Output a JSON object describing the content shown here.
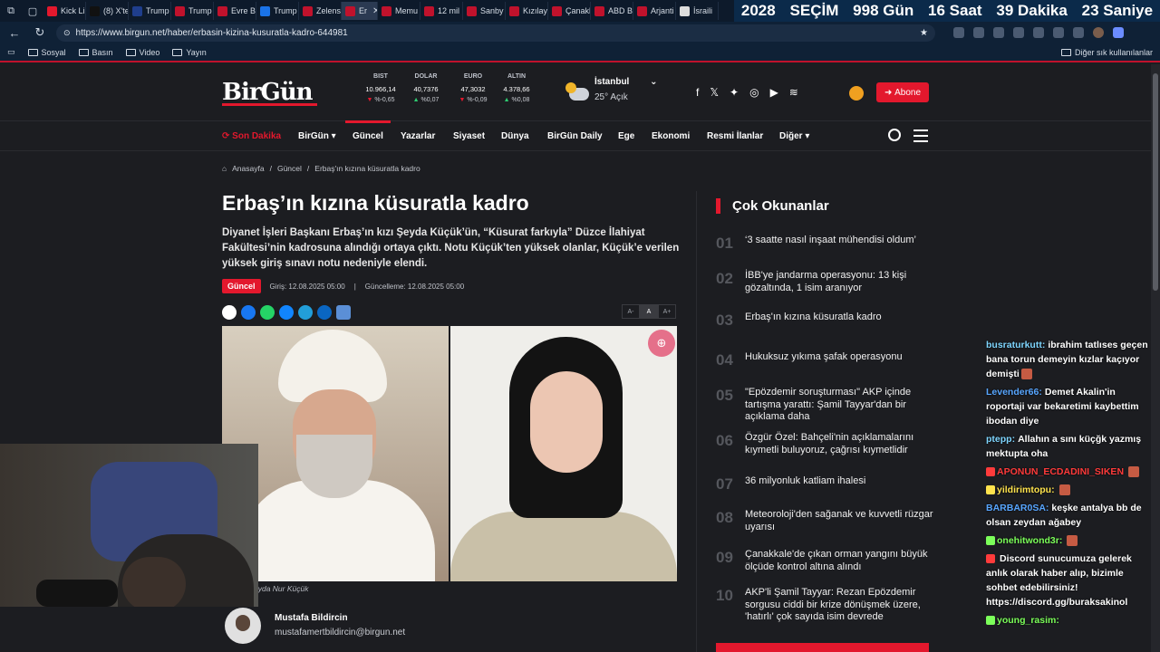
{
  "browser": {
    "tabs": [
      {
        "label": "Kick Li",
        "color": "#e3182d"
      },
      {
        "label": "(8) X'te",
        "color": "#111111"
      },
      {
        "label": "Trump",
        "color": "#1f3e8c"
      },
      {
        "label": "Trump",
        "color": "#c0122c"
      },
      {
        "label": "Evre B",
        "color": "#c0122c"
      },
      {
        "label": "Trump",
        "color": "#1a73e8"
      },
      {
        "label": "Zelens",
        "color": "#c0122c"
      },
      {
        "label": "Er",
        "color": "#c0122c"
      },
      {
        "label": "Memu",
        "color": "#c0122c"
      },
      {
        "label": "12 mil",
        "color": "#c0122c"
      },
      {
        "label": "Sanby",
        "color": "#c0122c"
      },
      {
        "label": "Kızılay",
        "color": "#c0122c"
      },
      {
        "label": "Çanakk",
        "color": "#c0122c"
      },
      {
        "label": "ABD B",
        "color": "#c0122c"
      },
      {
        "label": "Arjanti",
        "color": "#c0122c"
      },
      {
        "label": "İsraili",
        "color": "#dddddd"
      }
    ],
    "url": "https://www.birgun.net/haber/erbasin-kizina-kusuratla-kadro-644981",
    "bookmarks": [
      "Sosyal",
      "Basın",
      "Video",
      "Yayın"
    ],
    "bookmarks_other": "Diğer sık kullanılanlar"
  },
  "countdown": {
    "year": "2028",
    "label": "SEÇİM",
    "days": "998 Gün",
    "hours": "16 Saat",
    "minutes": "39 Dakika",
    "seconds": "23 Saniye"
  },
  "site": {
    "logo": "BirGün",
    "markets": [
      {
        "label": "BIST",
        "value": "10.966,14",
        "change": "%-0,65",
        "dir": "down"
      },
      {
        "label": "DOLAR",
        "value": "40,7376",
        "change": "%0,07",
        "dir": "up"
      },
      {
        "label": "EURO",
        "value": "47,3032",
        "change": "%-0,09",
        "dir": "down"
      },
      {
        "label": "ALTIN",
        "value": "4.378,66",
        "change": "%0,08",
        "dir": "up"
      }
    ],
    "weather": {
      "city": "İstanbul",
      "temp": "25° Açık"
    },
    "subscribe": "Abone",
    "nav": [
      "Son Dakika",
      "BirGün",
      "Güncel",
      "Yazarlar",
      "Siyaset",
      "Dünya",
      "BirGün Daily",
      "Ege",
      "Ekonomi",
      "Resmi İlanlar",
      "Diğer"
    ]
  },
  "article": {
    "breadcrumb": [
      "Anasayfa",
      "Güncel",
      "Erbaş'ın kızına küsuratla kadro"
    ],
    "title": "Erbaş’ın kızına küsuratla kadro",
    "lead": "Diyanet İşleri Başkanı Erbaş’ın kızı Şeyda Küçük’ün, “Küsurat farkıyla” Düzce İlahiyat Fakültesi’nin kadrosuna alındığı ortaya çıktı. Notu Küçük’ten yüksek olanlar, Küçük’e verilen yüksek giriş sınavı notu nedeniyle elendi.",
    "category": "Güncel",
    "published": "Giriş: 12.08.2025 05:00",
    "updated": "Güncelleme: 12.08.2025 05:00",
    "font_controls": [
      "A-",
      "A",
      "A+"
    ],
    "caption": "eyda Nur Küçük",
    "author": {
      "name": "Mustafa Bildircin",
      "email": "mustafamertbildircin@birgun.net"
    }
  },
  "most_read": {
    "title": "Çok Okunanlar",
    "items": [
      {
        "num": "01",
        "text": "‘3 saatte nasıl inşaat mühendisi oldum’"
      },
      {
        "num": "02",
        "text": "İBB'ye jandarma operasyonu: 13 kişi gözaltında, 1 isim aranıyor"
      },
      {
        "num": "03",
        "text": "Erbaş'ın kızına küsuratla kadro"
      },
      {
        "num": "04",
        "text": "Hukuksuz yıkıma şafak operasyonu"
      },
      {
        "num": "05",
        "text": "\"Epözdemir soruşturması\" AKP içinde tartışma yarattı: Şamil Tayyar'dan bir açıklama daha"
      },
      {
        "num": "06",
        "text": "Özgür Özel: Bahçeli'nin açıklamalarını kıymetli buluyoruz, çağrısı kıymetlidir"
      },
      {
        "num": "07",
        "text": "36 milyonluk katliam ihalesi"
      },
      {
        "num": "08",
        "text": "Meteoroloji'den sağanak ve kuvvetli rüzgar uyarısı"
      },
      {
        "num": "09",
        "text": "Çanakkale'de çıkan orman yangını büyük ölçüde kontrol altına alındı"
      },
      {
        "num": "10",
        "text": "AKP'li Şamil Tayyar: Rezan Epözdemir sorgusu ciddi bir krize dönüşmek üzere, 'hatırlı' çok sayıda isim devrede"
      }
    ]
  },
  "chat": [
    {
      "user": "busraturkutt:",
      "color": "#7fd6ff",
      "text": "ibrahim tatlıses geçen bana torun demeyin kızlar kaçıyor demişti"
    },
    {
      "user": "Levender66:",
      "color": "#58a6ff",
      "text": "Demet Akalin'in roportaji var bekaretimi kaybettim ibodan diye"
    },
    {
      "user": "ptepp:",
      "color": "#7fd6ff",
      "text": "Allahın a sını küçğk yazmış mektupta oha"
    },
    {
      "user": "APONUN_ECDADINI_SIKEN",
      "color": "#ff3b3b",
      "text": ""
    },
    {
      "user": "yildirimtopu:",
      "color": "#ffe34d",
      "text": ""
    },
    {
      "user": "BARBAR0SA:",
      "color": "#58a6ff",
      "text": "keşke antalya bb de olsan zeydan ağabey"
    },
    {
      "user": "onehitwond3r:",
      "color": "#7cff5a",
      "text": ""
    },
    {
      "user": "",
      "color": "#ff3b3b",
      "text": "Discord sunucumuza gelerek anlık olarak haber alıp, bizimle sohbet edebilirsiniz! https://discord.gg/buraksakinol"
    },
    {
      "user": "young_rasim:",
      "color": "#7cff5a",
      "text": ""
    }
  ]
}
